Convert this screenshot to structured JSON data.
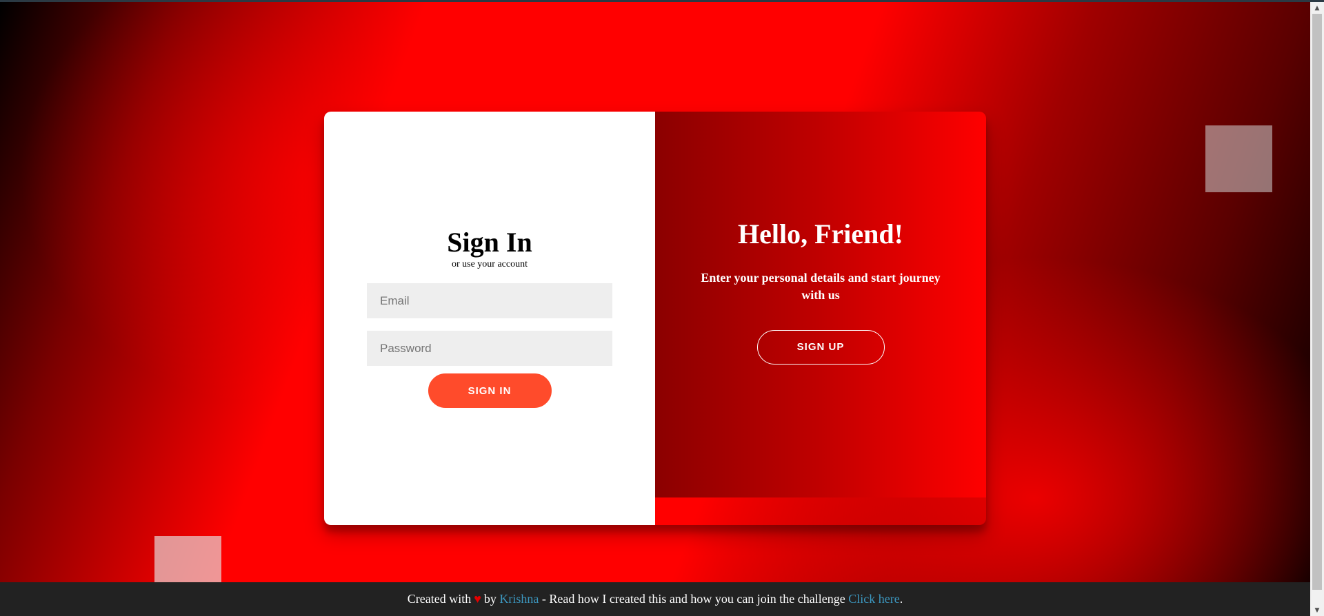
{
  "signin": {
    "title": "Sign In",
    "subtitle": "or use your account",
    "email_placeholder": "Email",
    "password_placeholder": "Password",
    "button_label": "Sign In"
  },
  "overlay": {
    "title": "Hello, Friend!",
    "text": "Enter your personal details and start journey with us",
    "button_label": "Sign Up"
  },
  "footer": {
    "prefix": "Created with",
    "heart": "♥",
    "by": "by",
    "author": "Krishna",
    "middle": "- Read how I created this and how you can join the challenge",
    "link": "Click here",
    "suffix": "."
  },
  "colors": {
    "accent": "#ff4b2b",
    "link": "#3c97bf",
    "footer_bg": "#222222",
    "overlay_start": "#8b0000",
    "overlay_end": "#ff0000"
  },
  "icons": {
    "heart": "heart-icon",
    "scroll_up": "scroll-up-arrow-icon",
    "scroll_down": "scroll-down-arrow-icon"
  }
}
